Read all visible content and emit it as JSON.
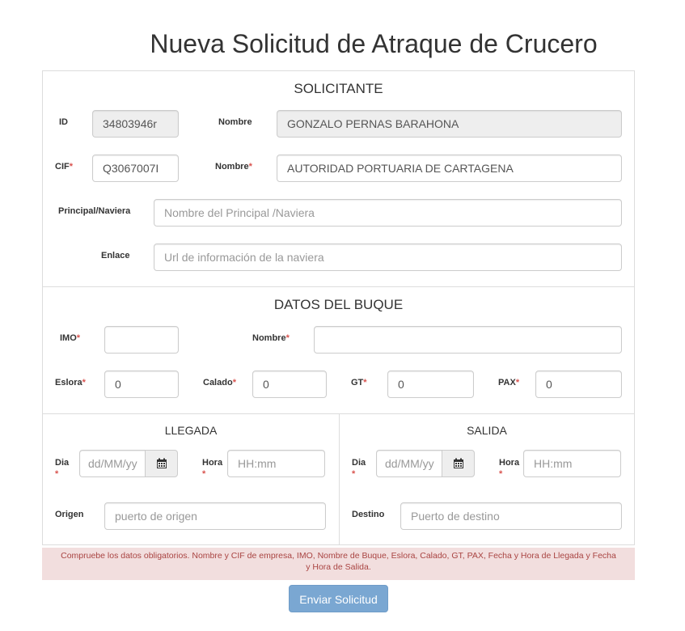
{
  "title": "Nueva Solicitud de Atraque de Crucero",
  "solicitante": {
    "title": "SOLICITANTE",
    "id_label": "ID",
    "id_value": "34803946r",
    "nombre_label": "Nombre",
    "nombre_value": "GONZALO PERNAS BARAHONA",
    "cif_label": "CIF",
    "cif_value": "Q3067007I",
    "nombre_emp_label": "Nombre",
    "nombre_emp_value": "AUTORIDAD PORTUARIA DE CARTAGENA",
    "principal_label": "Principal/Naviera",
    "principal_placeholder": "Nombre del Principal /Naviera",
    "enlace_label": "Enlace",
    "enlace_placeholder": "Url de información de la naviera"
  },
  "buque": {
    "title": "DATOS DEL BUQUE",
    "imo_label": "IMO",
    "imo_value": "",
    "nombre_label": "Nombre",
    "nombre_value": "",
    "eslora_label": "Eslora",
    "eslora_value": "0",
    "calado_label": "Calado",
    "calado_value": "0",
    "gt_label": "GT",
    "gt_value": "0",
    "pax_label": "PAX",
    "pax_value": "0"
  },
  "llegada": {
    "title": "LLEGADA",
    "dia_label": "Dia",
    "dia_placeholder": "dd/MM/yy",
    "hora_label": "Hora",
    "hora_placeholder": "HH:mm",
    "origen_label": "Origen",
    "origen_placeholder": "puerto de origen"
  },
  "salida": {
    "title": "SALIDA",
    "dia_label": "Dia",
    "dia_placeholder": "dd/MM/yy",
    "hora_label": "Hora",
    "hora_placeholder": "HH:mm",
    "destino_label": "Destino",
    "destino_placeholder": "Puerto de destino"
  },
  "required_mark": "*",
  "alert_text": "Compruebe los datos obligatorios. Nombre y CIF de empresa, IMO, Nombre de Buque, Eslora, Calado, GT, PAX, Fecha y Hora de Llegada y Fecha y Hora de Salida.",
  "submit_label": "Enviar Solicitud",
  "colors": {
    "alert_bg": "#f2dede",
    "alert_text": "#a94442",
    "button_bg": "#7aa7d2",
    "required": "#d9534f"
  },
  "icons": {
    "calendar": "calendar-icon"
  }
}
